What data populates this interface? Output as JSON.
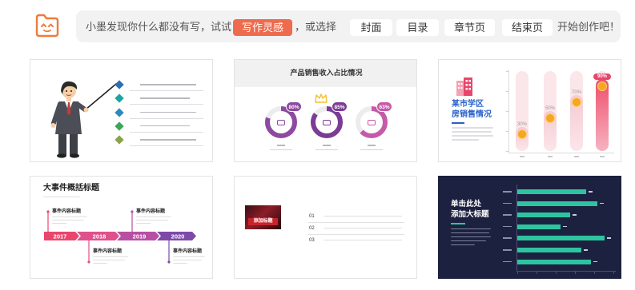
{
  "toolbar": {
    "prompt": "小墨发现你什么都没有写，试试",
    "inspire_label": "写作灵感",
    "or_choose": "，或选择",
    "options": [
      "封面",
      "目录",
      "章节页",
      "结束页"
    ],
    "cta": "开始创作吧！"
  },
  "colors": {
    "accent": "#ee6b4d",
    "panel": "#f2f2f3",
    "dark_slide": "#1c2140",
    "bar_green": "#2ec4a0"
  },
  "slides": [
    {
      "icon_colors": [
        "#2a6eb5",
        "#1aa6a0",
        "#2a8ac0",
        "#3aa65a",
        "#8aa34a"
      ],
      "icons": [
        "diamond-icon",
        "diamond-icon",
        "diamond-icon",
        "diamond-icon",
        "diamond-icon"
      ]
    },
    {
      "title": "产品销售收入占比情况",
      "rings": [
        {
          "percent": 80,
          "label": "80%",
          "color": "#8c4aa0",
          "icon": "card-icon"
        },
        {
          "percent": 85,
          "label": "85%",
          "color": "#7b3c95",
          "icon": "car-icon"
        },
        {
          "percent": 63,
          "label": "63%",
          "color": "#c65aa8",
          "icon": "scooter-icon"
        }
      ]
    },
    {
      "title_lines": [
        "某市学区",
        "房销售情况"
      ],
      "bars": [
        {
          "label": "30%",
          "level": 0.3
        },
        {
          "label": "50%",
          "level": 0.5
        },
        {
          "label": "70%",
          "level": 0.7
        },
        {
          "label": "90%",
          "level": 0.9
        }
      ]
    },
    {
      "title": "大事件概括标题",
      "years": [
        "2017",
        "2018",
        "2019",
        "2020"
      ],
      "year_colors": [
        "#e8466c",
        "#e0508c",
        "#b84fa2",
        "#7d4aa8"
      ],
      "events": [
        "事件内容标题",
        "事件内容标题",
        "事件内容标题",
        "事件内容标题"
      ]
    },
    {
      "image_caption": "添加标题",
      "items": [
        "01",
        "02",
        "03"
      ]
    },
    {
      "title_lines": [
        "单击此处",
        "添加大标题"
      ],
      "bar_levels": [
        0.73,
        0.85,
        0.56,
        0.46,
        0.92,
        0.68,
        0.78
      ]
    }
  ]
}
